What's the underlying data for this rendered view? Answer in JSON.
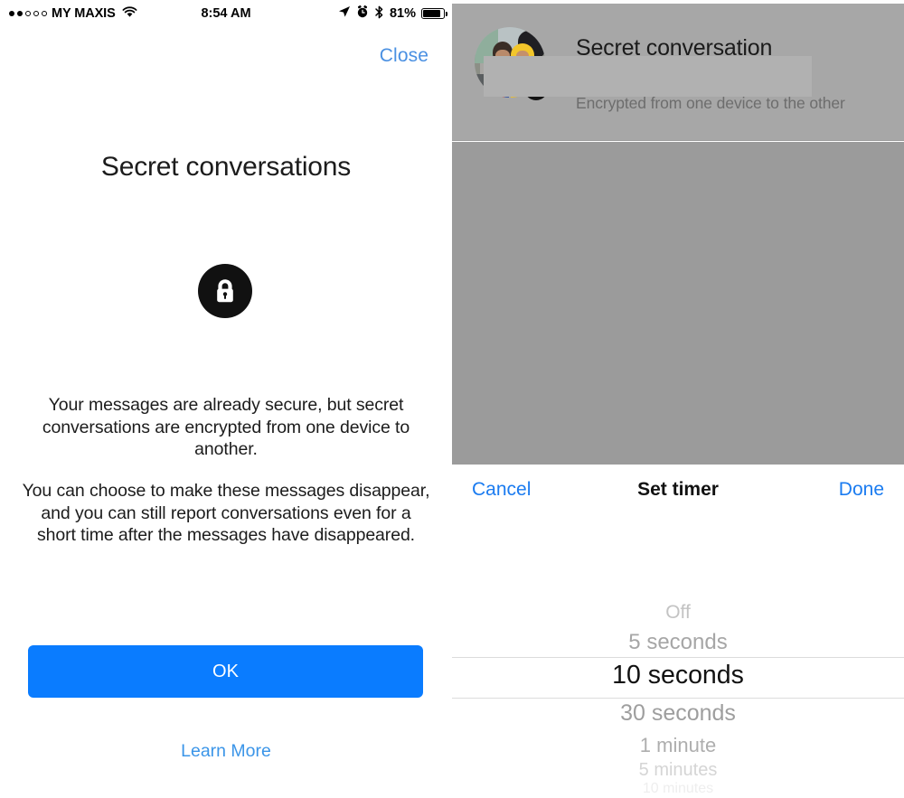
{
  "status_bar": {
    "signal_dots": [
      "filled",
      "filled",
      "hollow",
      "hollow",
      "hollow"
    ],
    "carrier": "MY MAXIS",
    "wifi_icon": "wifi-icon",
    "time": "8:54 AM",
    "location_icon": "location-arrow-icon",
    "alarm_icon": "alarm-clock-icon",
    "bluetooth_icon": "bluetooth-icon",
    "battery_percent": "81%",
    "battery_icon": "battery-full-icon"
  },
  "left_panel": {
    "close_label": "Close",
    "title": "Secret conversations",
    "lock_icon": "padlock-icon",
    "paragraph_1": "Your messages are already secure, but secret conversations are encrypted from one device to another.",
    "paragraph_2": "You can choose to make these messages disappear, and you can still report conversations even for a short time after the messages have disappeared.",
    "ok_label": "OK",
    "learn_more_label": "Learn More"
  },
  "right_panel": {
    "conversation_header": {
      "avatar_name": "avatar",
      "avatar_lock_badge_icon": "padlock-badge-icon",
      "title": "Secret conversation",
      "subtitle": "Encrypted from one device to the other"
    },
    "timer_picker": {
      "cancel_label": "Cancel",
      "title": "Set timer",
      "done_label": "Done",
      "selected_value": "10 seconds",
      "options": [
        "Off",
        "5 seconds",
        "10 seconds",
        "30 seconds",
        "1 minute",
        "5 minutes",
        "10 minutes"
      ]
    }
  },
  "colors": {
    "ios_blue": "#0a7cff",
    "link_blue": "#4a90e2",
    "dim_overlay": "#9b9b9b",
    "header_gray": "#a7a7a7",
    "badge_black": "#111111"
  }
}
